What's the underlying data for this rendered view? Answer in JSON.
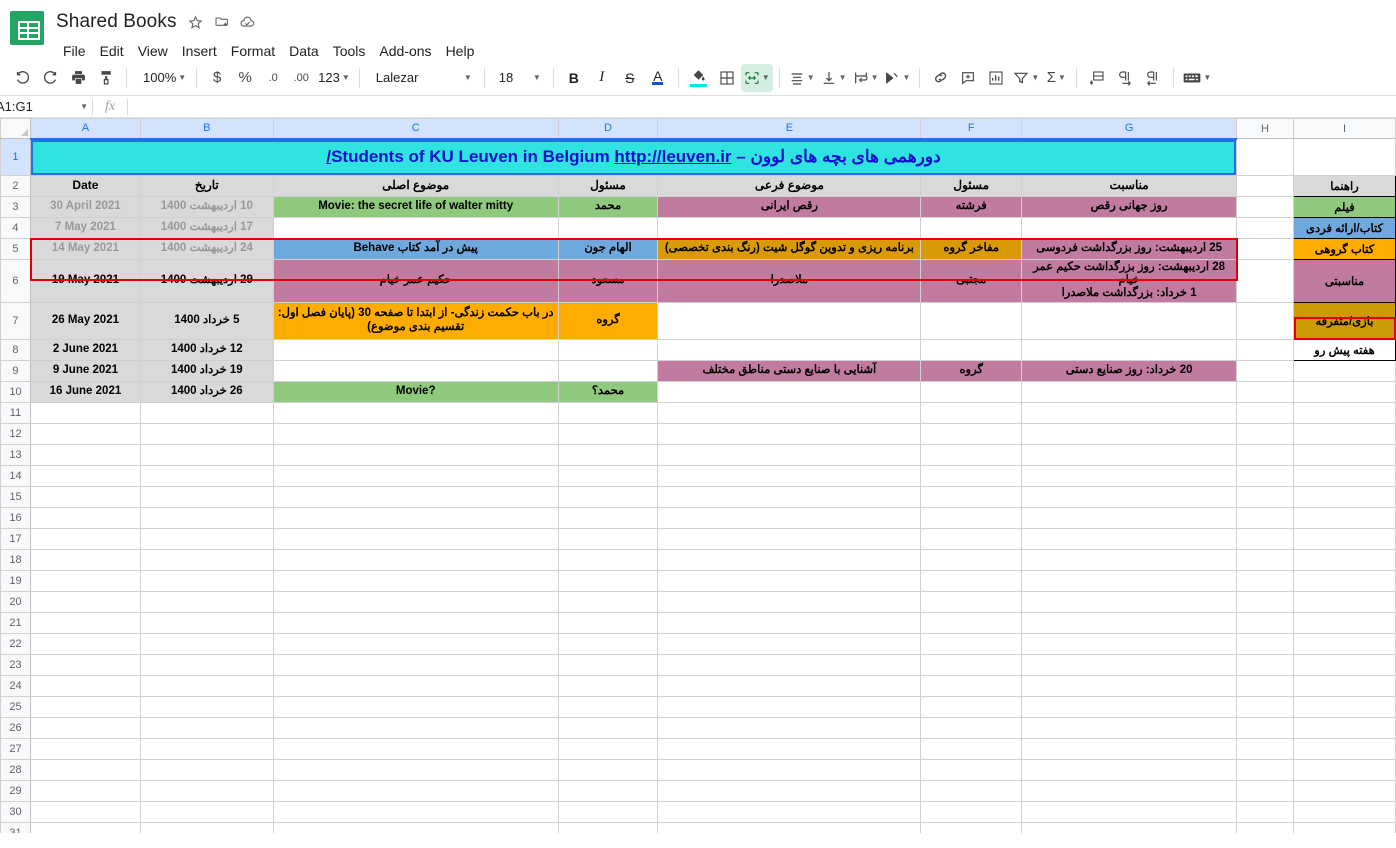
{
  "app": {
    "doc_title": "Shared Books",
    "logo_name": "sheets-logo",
    "title_icons": [
      {
        "name": "star-icon",
        "glyph": "☆"
      },
      {
        "name": "move-to-folder-icon",
        "glyph": "◇"
      },
      {
        "name": "cloud-saved-icon",
        "glyph": "◠"
      }
    ],
    "menus": [
      "File",
      "Edit",
      "View",
      "Insert",
      "Format",
      "Data",
      "Tools",
      "Add-ons",
      "Help"
    ]
  },
  "toolbar": {
    "undo": "↰",
    "redo": "↱",
    "print": "⎙",
    "paint_format": "⌸",
    "zoom": "100%",
    "currency": "$",
    "percent": "%",
    "decrease_decimal": ".0",
    "increase_decimal": ".00",
    "more_formats": "123",
    "font": "Lalezar",
    "font_size": "18",
    "bold": "B",
    "italic": "I",
    "strikethrough": "S",
    "text_color": "A",
    "fill_color": "◮",
    "borders": "⊞",
    "merge_cells": "⠿",
    "horizontal_align": "≡",
    "vertical_align": "⊥",
    "text_wrap": "⇥",
    "text_rotation": "⇗",
    "insert_link": "🔗",
    "insert_comment": "⊞",
    "insert_chart": "⊓",
    "create_filter": "▽",
    "functions": "Σ",
    "freeze": "⊟",
    "rtl_direction": "¶",
    "ltr_direction": "¶",
    "input_tools": "⌨"
  },
  "formula_bar": {
    "name_box": "A1:G1",
    "fx_label": "fx",
    "formula_value": ""
  },
  "grid": {
    "columns": [
      "A",
      "B",
      "C",
      "D",
      "E",
      "F",
      "G",
      "H",
      "I"
    ],
    "selected_columns": [
      "A",
      "B",
      "C",
      "D",
      "E",
      "F",
      "G"
    ],
    "selected_rows": [
      "1"
    ],
    "visible_rows": [
      1,
      2,
      3,
      4,
      5,
      6,
      7,
      8,
      9,
      10,
      11,
      12,
      13,
      14,
      15,
      16,
      17,
      18,
      19,
      20,
      21,
      22,
      23,
      24,
      25,
      26,
      27,
      28,
      29,
      30,
      31
    ],
    "title": {
      "text_rtl": "دورهمی های بچه های لوون – Students of KU Leuven in Belgium",
      "link": "http://leuven.ir/",
      "bg": "#2FE3E0",
      "color": "#1010CC"
    },
    "headers": {
      "A": "Date",
      "B": "تاریخ",
      "C": "موضوع اصلی",
      "D": "مسئول",
      "E": "موضوع فرعی",
      "F": "مسئول",
      "G": "مناسبت"
    },
    "rows": [
      {
        "row": 3,
        "past": true,
        "A": "30 April 2021",
        "B": "10 اردیبهشت 1400",
        "C": "Movie: the secret life of walter mitty",
        "C_bg": "#8FC97D",
        "D": "محمد",
        "D_bg": "#8FC97D",
        "E": "رقص ایرانی",
        "E_bg": "#C27BA0",
        "F": "فرشته",
        "F_bg": "#C27BA0",
        "G": "روز جهانی رقص",
        "G_bg": "#C27BA0"
      },
      {
        "row": 4,
        "past": true,
        "A": "7 May 2021",
        "B": "17 اردیبهشت 1400",
        "C": "",
        "C_bg": "#ffffff",
        "D": "",
        "D_bg": "#ffffff",
        "E": "",
        "E_bg": "#ffffff",
        "F": "",
        "F_bg": "#ffffff",
        "G": "",
        "G_bg": "#ffffff"
      },
      {
        "row": 5,
        "past": true,
        "A": "14 May 2021",
        "B": "24 اردیبهشت 1400",
        "C": "پیش در آمد کتاب Behave",
        "C_bg": "#6FA8DC",
        "D": "الهام جون",
        "D_bg": "#6FA8DC",
        "E": "برنامه ریزی و تدوین گوگل شیت (رنگ بندی تخصصی)",
        "E_bg": "#D99B05",
        "F": "مفاخر گروه",
        "F_bg": "#D99B05",
        "G": "25 اردیبهشت: روز بزرگداشت فردوسی",
        "G_bg": "#C27BA0"
      },
      {
        "row": 6,
        "past": false,
        "highlight": true,
        "A": "19 May 2021",
        "B": "29 اردیبهشت 1400",
        "C": "حکیم عمر خیام",
        "C_bg": "#C27BA0",
        "D": "مسعود",
        "D_bg": "#C27BA0",
        "E": "ملاصدرا",
        "E_bg": "#C27BA0",
        "F": "مجتبی",
        "F_bg": "#C27BA0",
        "G": "28 اردیبهشت: روز بزرگداشت حکیم عمر خیام\n1 خرداد: بزرگداشت ملاصدرا",
        "G_bg": "#C27BA0"
      },
      {
        "row": 7,
        "past": false,
        "A": "26 May 2021",
        "B": "5 خرداد 1400",
        "C": "در باب حکمت زندگی- از ابتدا تا صفحه 30 (پایان فصل اول: تقسیم بندی موضوع)",
        "C_bg": "#FFAB00",
        "D": "گروه",
        "D_bg": "#FFAB00",
        "E": "",
        "E_bg": "#ffffff",
        "F": "",
        "F_bg": "#ffffff",
        "G": "",
        "G_bg": "#ffffff"
      },
      {
        "row": 8,
        "past": false,
        "A": "2 June 2021",
        "B": "12 خرداد 1400",
        "C": "",
        "C_bg": "#ffffff",
        "D": "",
        "D_bg": "#ffffff",
        "E": "",
        "E_bg": "#ffffff",
        "F": "",
        "F_bg": "#ffffff",
        "G": "",
        "G_bg": "#ffffff"
      },
      {
        "row": 9,
        "past": false,
        "A": "9 June 2021",
        "B": "19 خرداد 1400",
        "C": "",
        "C_bg": "#ffffff",
        "D": "",
        "D_bg": "#ffffff",
        "E": "آشنایی با صنایع دستی مناطق مختلف",
        "E_bg": "#C27BA0",
        "F": "گروه",
        "F_bg": "#C27BA0",
        "G": "20 خرداد: روز صنایع دستی",
        "G_bg": "#C27BA0"
      },
      {
        "row": 10,
        "past": false,
        "A": "16 June 2021",
        "B": "26 خرداد 1400",
        "C": "Movie?",
        "C_bg": "#8FC97D",
        "D": "محمد؟",
        "D_bg": "#8FC97D",
        "E": "",
        "E_bg": "#ffffff",
        "F": "",
        "F_bg": "#ffffff",
        "G": "",
        "G_bg": "#ffffff"
      }
    ],
    "legend": {
      "column": "I",
      "items": [
        {
          "row": 2,
          "label": "راهنما",
          "bg": "#D9D9D9"
        },
        {
          "row": 3,
          "label": "فیلم",
          "bg": "#8FC97D"
        },
        {
          "row": 4,
          "label": "کتاب/ارائه فردی",
          "bg": "#6FA8DC"
        },
        {
          "row": 5,
          "label": "کتاب گروهی",
          "bg": "#FFAB00"
        },
        {
          "row": 6,
          "label": "مناسبتی",
          "bg": "#C27BA0"
        },
        {
          "row": 7,
          "label": "بازی/متفرقه",
          "bg": "#CC9A06"
        },
        {
          "row": 8,
          "label": "هفته پیش رو",
          "bg": "#FFFFFF",
          "outlined": true
        }
      ]
    }
  }
}
